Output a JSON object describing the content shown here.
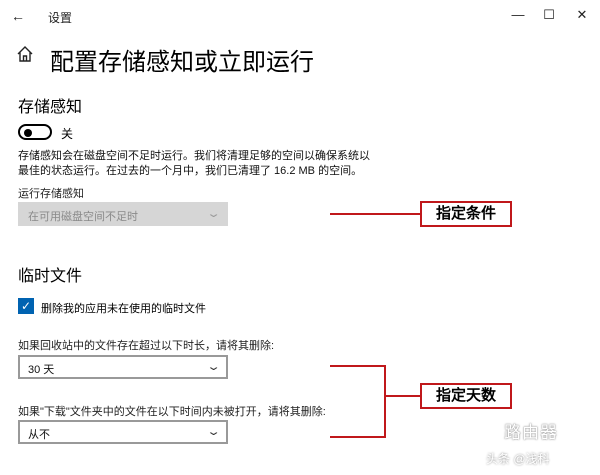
{
  "window": {
    "app_title": "设置",
    "back_icon": "←",
    "minimize_icon": "—",
    "maximize_icon": "☐",
    "close_icon": "✕"
  },
  "page": {
    "title": "配置存储感知或立即运行",
    "home_icon": "home-icon"
  },
  "storage_sense": {
    "heading": "存储感知",
    "toggle_state": "关",
    "description_line1": "存储感知会在磁盘空间不足时运行。我们将清理足够的空间以确保系统以",
    "description_line2": "最佳的状态运行。在过去的一个月中，我们已清理了 16.2 MB 的空间。",
    "run_label": "运行存储感知",
    "run_selected": "在可用磁盘空间不足时"
  },
  "temp_files": {
    "heading": "临时文件",
    "checkbox_label": "删除我的应用未在使用的临时文件",
    "checkbox_checked": true,
    "recycle_label": "如果回收站中的文件存在超过以下时长，请将其删除:",
    "recycle_selected": "30 天",
    "downloads_label": "如果\"下载\"文件夹中的文件在以下时间内未被打开，请将其删除:",
    "downloads_selected": "从不"
  },
  "annotations": {
    "condition_label": "指定条件",
    "days_label": "指定天数",
    "color": "#c0181b"
  },
  "watermark": {
    "brand": "路由器",
    "source": "头条 @浅科"
  }
}
